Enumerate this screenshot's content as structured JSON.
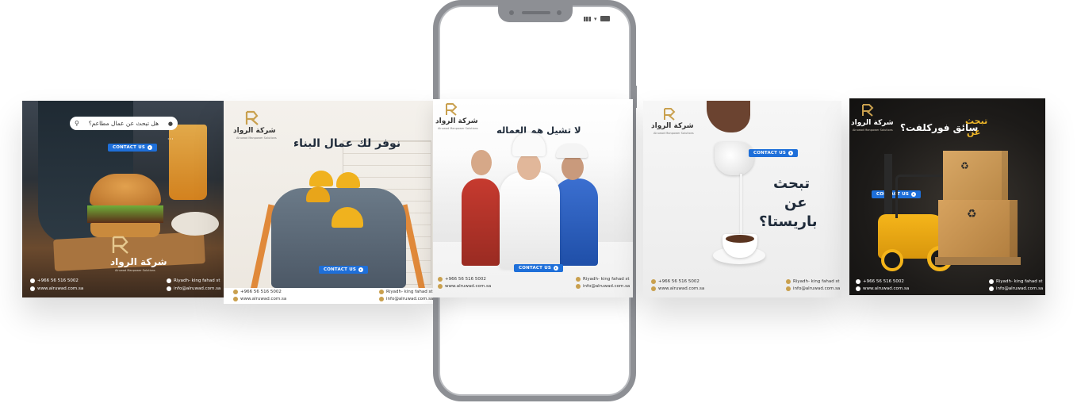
{
  "brand": {
    "name": "شركة الرواد",
    "tagline": "Alruwad Manpower Solutions"
  },
  "contact": {
    "button_label": "CONTACT US",
    "phone": "+966 56 516 5002",
    "address": "Riyadh- king fahad st",
    "website": "www.alruwad.com.sa",
    "email": "info@alruwad.com.sa"
  },
  "cards": {
    "restaurant": {
      "search_placeholder": "هل تبحث عن عمال مطاعم؟"
    },
    "construction": {
      "headline": "نوفر لك عمال البناء"
    },
    "workers": {
      "headline": "لا تشيل هم العماله"
    },
    "barista": {
      "line1": "تبحث",
      "line2": "عن",
      "line3": "باريستا؟"
    },
    "forklift": {
      "line1": "تبحث",
      "line2": "عن",
      "line3": "سائق فوركلفت؟"
    }
  },
  "colors": {
    "gold": "#c9a04e",
    "button_blue": "#1e6fd9",
    "phone_frame": "#8d8f94"
  },
  "icons": [
    "search-icon",
    "mic-icon",
    "phone-icon",
    "location-icon",
    "globe-icon",
    "mail-icon",
    "signal-icon",
    "wifi-icon",
    "battery-icon"
  ]
}
